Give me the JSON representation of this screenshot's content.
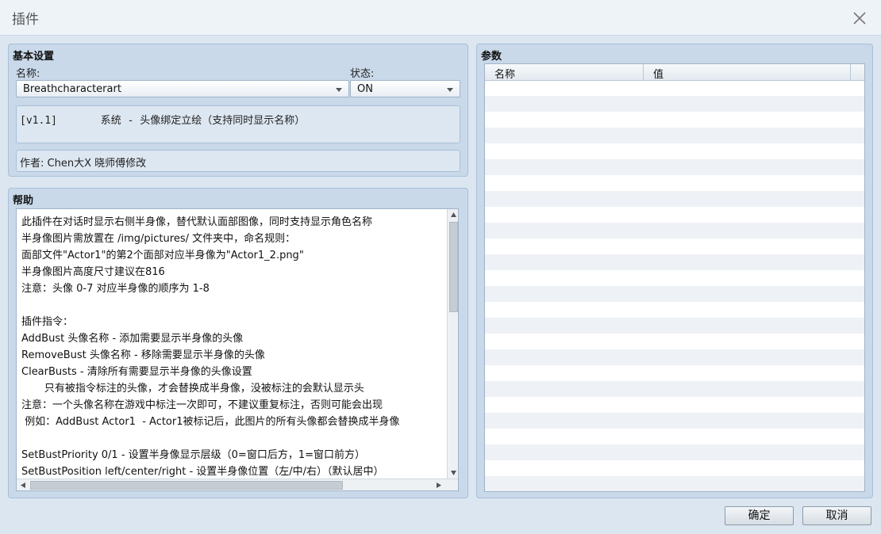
{
  "window": {
    "title": "插件"
  },
  "basic": {
    "title": "基本设置",
    "name_label": "名称:",
    "name_value": "Breathcharacterart",
    "status_label": "状态:",
    "status_value": "ON",
    "description": "[v1.1]       系统 - 头像绑定立绘（支持同时显示名称）",
    "author": "作者: Chen大X 晓师傅修改"
  },
  "help": {
    "title": "帮助",
    "lines": [
      "此插件在对话时显示右侧半身像，替代默认面部图像，同时支持显示角色名称",
      "半身像图片需放置在 /img/pictures/ 文件夹中，命名规则：",
      "面部文件\"Actor1\"的第2个面部对应半身像为\"Actor1_2.png\"",
      "半身像图片高度尺寸建议在816",
      "注意：头像 0-7 对应半身像的顺序为 1-8",
      "",
      "插件指令：",
      "AddBust 头像名称 - 添加需要显示半身像的头像",
      "RemoveBust 头像名称 - 移除需要显示半身像的头像",
      "ClearBusts - 清除所有需要显示半身像的头像设置",
      "       只有被指令标注的头像，才会替换成半身像，没被标注的会默认显示头",
      "注意：一个头像名称在游戏中标注一次即可，不建议重复标注，否则可能会出现",
      " 例如：AddBust Actor1  - Actor1被标记后，此图片的所有头像都会替换成半身像",
      "",
      "SetBustPriority 0/1 - 设置半身像显示层级（0=窗口后方，1=窗口前方）",
      "SetBustPosition left/center/right - 设置半身像位置（左/中/右）（默认居中）"
    ]
  },
  "params": {
    "title": "参数",
    "col_name": "名称",
    "col_value": "值"
  },
  "buttons": {
    "ok": "确定",
    "cancel": "取消"
  }
}
